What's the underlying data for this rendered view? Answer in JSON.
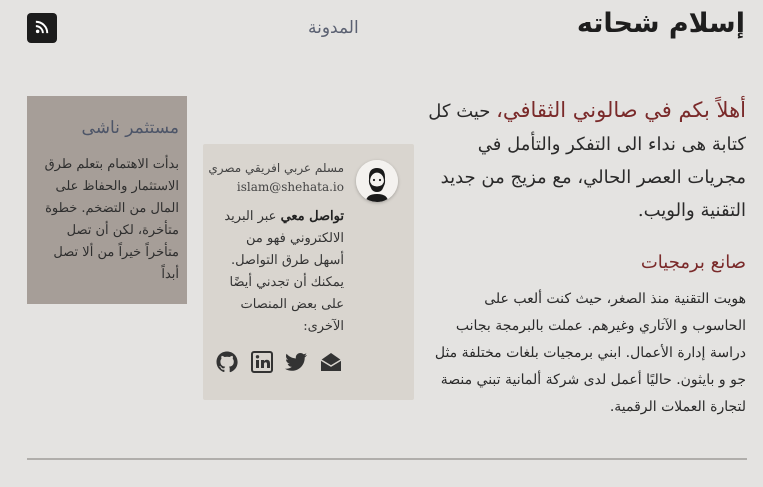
{
  "header": {
    "site_title": "إسلام شحاته",
    "nav_blog": "المدونة",
    "rss_icon": "rss-icon"
  },
  "intro": {
    "welcome": "أهلاً بكم في صالوني الثقافي،",
    "rest": " حيث كل كتابة هى نداء الى التفكر والتأمل في مجريات العصر الحالي، مع مزيج من جديد التقنية والويب."
  },
  "section": {
    "title": "صانع برمجيات",
    "body": "هويت التقنية منذ الصغر، حيث كنت ألعب على الحاسوب و الآتاري وغيرهم. عملت بالبرمجة بجانب دراسة إدارة الأعمال. ابني برمجيات بلغات مختلفة مثل جو و بايثون. حاليًا أعمل لدى شركة ألمانية تبني منصة لتجارة العملات الرقمية."
  },
  "contact": {
    "name": "مسلم عربي افريقي مصري",
    "email": "islam@shehata.io",
    "lead": "تواصل معي",
    "text": " عبر البريد الالكتروني فهو من أسهل طرق التواصل. يمكنك أن تجدني أيضًا على بعض المنصات الآخرى:",
    "icons": [
      "envelope-icon",
      "twitter-icon",
      "linkedin-icon",
      "github-icon"
    ]
  },
  "side": {
    "title": "مستثمر ناشى",
    "text": "بدأت الاهتمام بتعلم طرق الاستثمار والحفاظ على المال من التضخم. خطوة متأخرة، لكن أن تصل متأخراً خيراً من ألا تصل أبداً"
  },
  "colors": {
    "background": "#e4e3e1",
    "accent": "#7a2a2a",
    "card": "#d9d5cf",
    "side_card": "#a69e98"
  }
}
